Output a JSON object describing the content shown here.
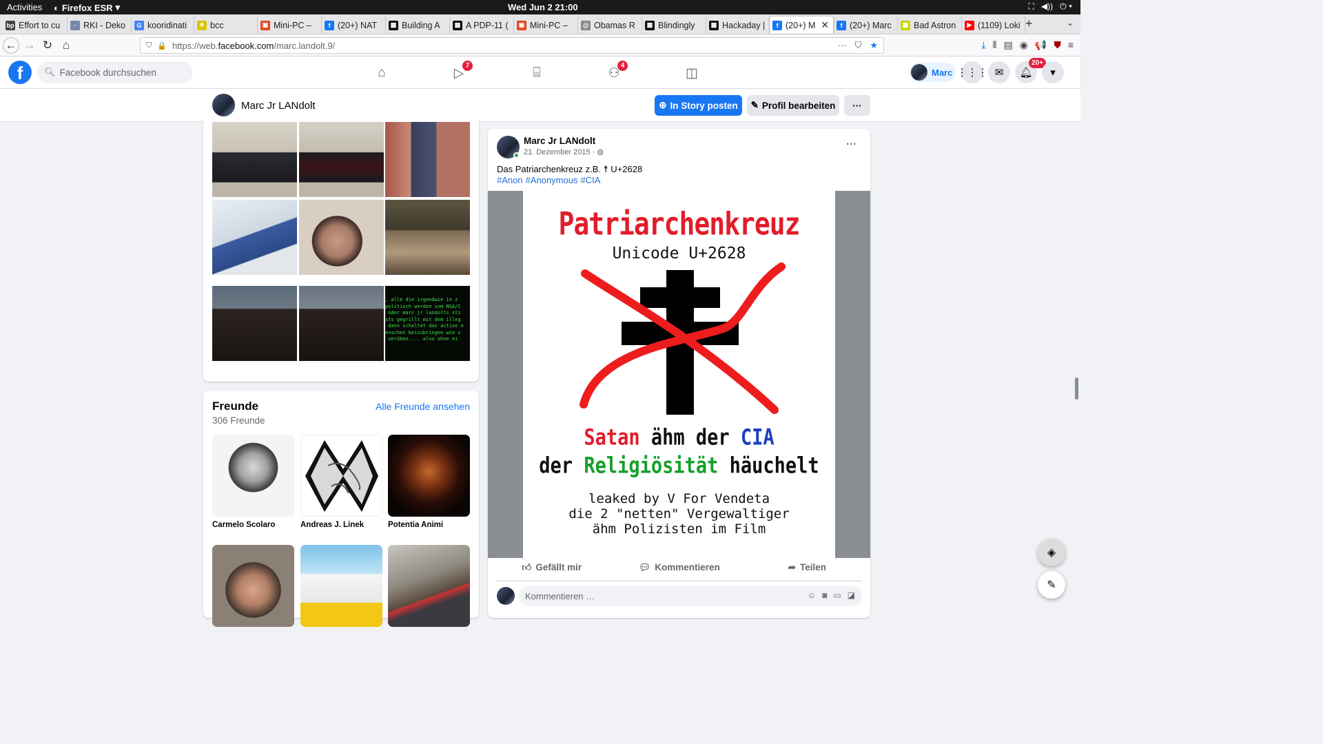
{
  "system": {
    "activities": "Activities",
    "app_name": "Firefox ESR",
    "clock": "Wed Jun 2  21:00"
  },
  "tabs": [
    {
      "label": "Effort to cu",
      "color": "#444444",
      "glyph": "bp"
    },
    {
      "label": "RKI - Deko",
      "color": "#7788aa",
      "glyph": "·"
    },
    {
      "label": "kooridinati",
      "color": "#4285f4",
      "glyph": "G"
    },
    {
      "label": "bcc",
      "color": "#d9c400",
      "glyph": "✳"
    },
    {
      "label": "Mini-PC –",
      "color": "#e8431b",
      "glyph": "▣"
    },
    {
      "label": "(20+) NAT",
      "color": "#1877f2",
      "glyph": "f"
    },
    {
      "label": "Building A",
      "color": "#111111",
      "glyph": "▩"
    },
    {
      "label": "A PDP-11 (",
      "color": "#111111",
      "glyph": "▩"
    },
    {
      "label": "Mini-PC –",
      "color": "#e8431b",
      "glyph": "▣"
    },
    {
      "label": "Obamas R",
      "color": "#888888",
      "glyph": "@"
    },
    {
      "label": "Blindingly",
      "color": "#111111",
      "glyph": "▩"
    },
    {
      "label": "Hackaday |",
      "color": "#111111",
      "glyph": "▩"
    },
    {
      "label": "(20+) M",
      "color": "#1877f2",
      "glyph": "f"
    },
    {
      "label": "(20+) Marc",
      "color": "#1877f2",
      "glyph": "f"
    },
    {
      "label": "Bad Astron",
      "color": "#c8d400",
      "glyph": "▦"
    },
    {
      "label": "(1109) Loki",
      "color": "#ff0000",
      "glyph": "▶"
    }
  ],
  "url": {
    "prefix": "https://web.",
    "host": "facebook.com",
    "path": "/marc.landolt.9/"
  },
  "header": {
    "search_placeholder": "Facebook durchsuchen",
    "watch_badge": "7",
    "groups_badge": "4",
    "notif_badge": "20+",
    "profile_name": "Marc"
  },
  "profile_bar": {
    "name": "Marc Jr LANdolt",
    "story_button": "In Story posten",
    "edit_button": "Profil bearbeiten",
    "more_button": "···"
  },
  "photos": {
    "terminal_text": ", alle die irgendwie in z\npolitisch werden vom NSA/C\n oder marc jr landolts sti\nsts gegrillt mit dem illeg\n dann schaltet das active e\nenschen beizubringen wie s\n verüben.... also ohne ei"
  },
  "friends": {
    "title": "Freunde",
    "count": "306 Freunde",
    "see_all": "Alle Freunde ansehen",
    "list": [
      {
        "name": "Carmelo Scolaro"
      },
      {
        "name": "Andreas J. Linek"
      },
      {
        "name": "Potentia Animi"
      },
      {
        "name": ""
      },
      {
        "name": ""
      },
      {
        "name": ""
      }
    ]
  },
  "post": {
    "author": "Marc Jr LANdolt",
    "date": "21. Dezember 2015 ·",
    "text": "Das Patriarchenkreuz z.B. ☨ U+2628",
    "tags": [
      "#Anon",
      "#Anonymous",
      "#CIA"
    ],
    "image": {
      "title": "Patriarchenkreuz",
      "subtitle": "Unicode U+2628",
      "line1_a": "Satan",
      "line1_b": " ähm der ",
      "line1_c": "CIA",
      "line2_a": "der ",
      "line2_b": "Religiösität",
      "line2_c": " häuchelt",
      "leak1": "leaked by V For Vendeta",
      "leak2": "die 2 \"netten\" Vergewaltiger",
      "leak3": "ähm Polizisten im Film",
      "colors": {
        "red": "#e11d2a",
        "blue": "#1a3fc0",
        "green": "#17a02a"
      }
    },
    "like": "Gefällt mir",
    "comment": "Kommentieren",
    "share": "Teilen",
    "comment_placeholder": "Kommentieren …"
  }
}
